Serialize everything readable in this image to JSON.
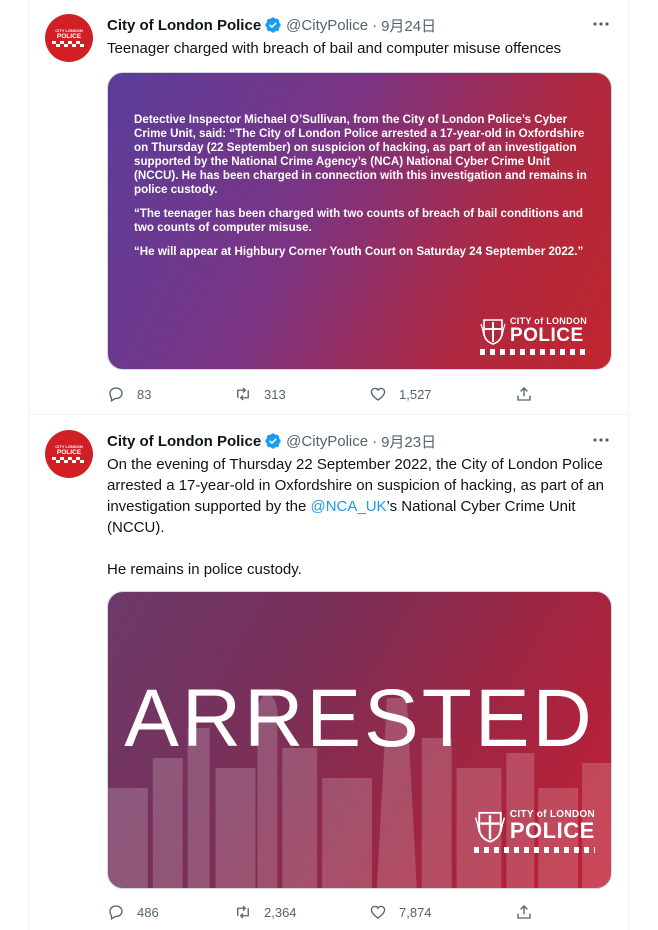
{
  "account": {
    "name": "City of London Police",
    "handle": "@CityPolice"
  },
  "logo": {
    "top": "CITY of LONDON",
    "main": "POLICE"
  },
  "tweets": [
    {
      "date": "9月24日",
      "text": "Teenager charged with breach of bail and computer misuse offences",
      "card_paragraphs": [
        "Detective Inspector Michael O’Sullivan, from the City of London Police’s Cyber Crime Unit, said: “The City of London Police arrested a 17-year-old in Oxfordshire on Thursday (22 September) on suspicion of hacking, as part of an investigation supported by the National Crime Agency’s (NCA) National Cyber Crime Unit (NCCU). He has been charged in connection with this investigation and remains in police custody.",
        "“The teenager has been charged with two counts of breach of bail conditions and two counts of computer misuse.",
        "“He will appear at Highbury Corner Youth Court on Saturday 24 September 2022.”"
      ],
      "replies": "83",
      "retweets": "313",
      "likes": "1,527"
    },
    {
      "date": "9月23日",
      "text_before_link": "On the evening of Thursday 22 September 2022, the City of London Police arrested a 17-year-old in Oxfordshire on suspicion of hacking, as part of an investigation supported by the ",
      "link": "@NCA_UK",
      "text_after_link": "’s National Cyber Crime Unit (NCCU).",
      "text_second": "He remains in police custody.",
      "card_headline": "ARRESTED",
      "replies": "486",
      "retweets": "2,364",
      "likes": "7,874"
    }
  ],
  "colors": {
    "brand_red": "#d11f26",
    "link": "#1d9bf0",
    "verified": "#1d9bf0",
    "muted": "#536471"
  },
  "icons": [
    "verified-badge-icon",
    "more-icon",
    "reply-icon",
    "retweet-icon",
    "like-icon",
    "share-icon",
    "crest-icon"
  ]
}
